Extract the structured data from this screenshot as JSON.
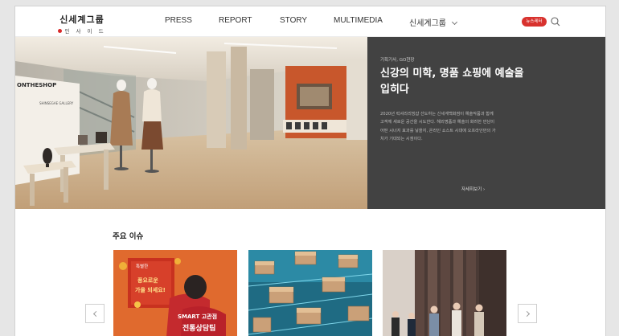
{
  "header": {
    "logo": {
      "main": "신세계그룹",
      "sub": "인 사 이 드"
    },
    "nav": [
      "PRESS",
      "REPORT",
      "STORY",
      "MULTIMEDIA",
      "신세계그룹"
    ],
    "news_badge": "뉴스레터"
  },
  "hero": {
    "category": "기획기사, GO현장",
    "title": "신강의 미학, 명품 쇼핑에 예술을 입히다",
    "body": "2020년 럭셔리리빙샵 선도하는 신세계백화점이 예술작품과 함께 고객께 새로운 공간을 시도한다. 해외명품과 예술의 화려한 만남이 어떤 시너지 효과를 낳을지, 온라인 쇼스트 시대에 오프라인만의 가치가 기대되는 시점이다.",
    "more": "자세히보기 ›",
    "store_sign": "ONTHESHOP",
    "store_sign_sub": "SHINSEGAE GALLERY"
  },
  "issues": {
    "title": "주요 이슈",
    "card1_text": [
      "특별한",
      "풍요로운",
      "가을 되세요!",
      "SMART 고관점",
      "전통상담팀"
    ]
  },
  "colors": {
    "accent": "#d8322e",
    "panel": "#424242"
  }
}
